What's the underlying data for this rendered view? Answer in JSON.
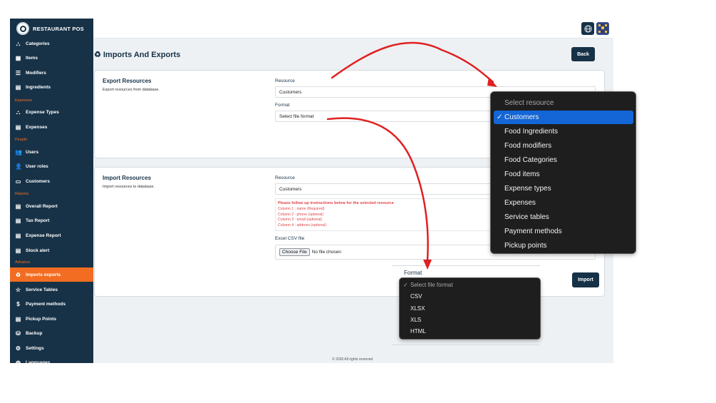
{
  "app": {
    "name": "RESTAURANT POS"
  },
  "sidebar": {
    "items": [
      {
        "label": "Categories",
        "icon": "sitemap-icon"
      },
      {
        "label": "Items",
        "icon": "table-icon"
      },
      {
        "label": "Modifiers",
        "icon": "list-icon"
      },
      {
        "label": "Ingredients",
        "icon": "document-icon"
      },
      {
        "section": "Expenses"
      },
      {
        "label": "Expense Types",
        "icon": "sitemap-icon"
      },
      {
        "label": "Expenses",
        "icon": "document-icon"
      },
      {
        "section": "People"
      },
      {
        "label": "Users",
        "icon": "users-icon"
      },
      {
        "label": "User roles",
        "icon": "user-cog-icon"
      },
      {
        "label": "Customers",
        "icon": "address-card-icon"
      },
      {
        "section": "Reports"
      },
      {
        "label": "Overall Report",
        "icon": "document-icon"
      },
      {
        "label": "Tax Report",
        "icon": "document-icon"
      },
      {
        "label": "Expense Report",
        "icon": "document-icon"
      },
      {
        "label": "Stock alert",
        "icon": "document-icon"
      },
      {
        "section": "Advance"
      },
      {
        "label": "Imports exports",
        "icon": "recycle-icon",
        "active": true
      },
      {
        "label": "Service Tables",
        "icon": "star-icon"
      },
      {
        "label": "Payment methods",
        "icon": "dollar-icon"
      },
      {
        "label": "Pickup Points",
        "icon": "document-icon"
      },
      {
        "label": "Backup",
        "icon": "database-icon"
      },
      {
        "label": "Settings",
        "icon": "cogs-icon"
      },
      {
        "label": "Languages",
        "icon": "globe-icon"
      }
    ]
  },
  "colors": {
    "sidebar_bg": "#173247",
    "accent": "#f26d21",
    "primary_button": "#173247",
    "instruction_text": "#e0464b",
    "dropdown_bg": "#1e1e1e",
    "dropdown_selected": "#1466d6",
    "annotation_arrow": "#e02020"
  },
  "page": {
    "title": "Imports And Exports",
    "back_label": "Back"
  },
  "export_card": {
    "title": "Export Resources",
    "subtitle": "Export resources from database.",
    "resource_label": "Resource",
    "resource_value": "Customers",
    "format_label": "Format",
    "format_value": "Select file format"
  },
  "import_card": {
    "title": "Import Resources",
    "subtitle": "Import resources to database.",
    "resource_label": "Resource",
    "resource_value": "Customers",
    "instructions_heading": "Please follow up instructions below for the selected resource",
    "instructions": [
      "Column 1 : name (Required)",
      "Column 2 : phone (optional)",
      "Column 3 : email (optional)",
      "Column 4 : address (optional)"
    ],
    "file_label": "Excel CSV file",
    "choose_file_label": "Choose File",
    "no_file_text": "No file chosen",
    "format_label": "Format",
    "import_label": "Import"
  },
  "resource_dropdown": {
    "options": [
      {
        "label": "Select resource",
        "muted": true
      },
      {
        "label": "Customers",
        "selected": true
      },
      {
        "label": "Food Ingredients"
      },
      {
        "label": "Food modifiers"
      },
      {
        "label": "Food Categories"
      },
      {
        "label": "Food items"
      },
      {
        "label": "Expense types"
      },
      {
        "label": "Expenses"
      },
      {
        "label": "Service tables"
      },
      {
        "label": "Payment methods"
      },
      {
        "label": "Pickup points"
      }
    ]
  },
  "format_dropdown": {
    "options": [
      {
        "label": "Select file format",
        "selected": true
      },
      {
        "label": "CSV"
      },
      {
        "label": "XLSX"
      },
      {
        "label": "XLS"
      },
      {
        "label": "HTML"
      }
    ]
  },
  "footer": {
    "text": "© 2026 All rights reserved"
  }
}
